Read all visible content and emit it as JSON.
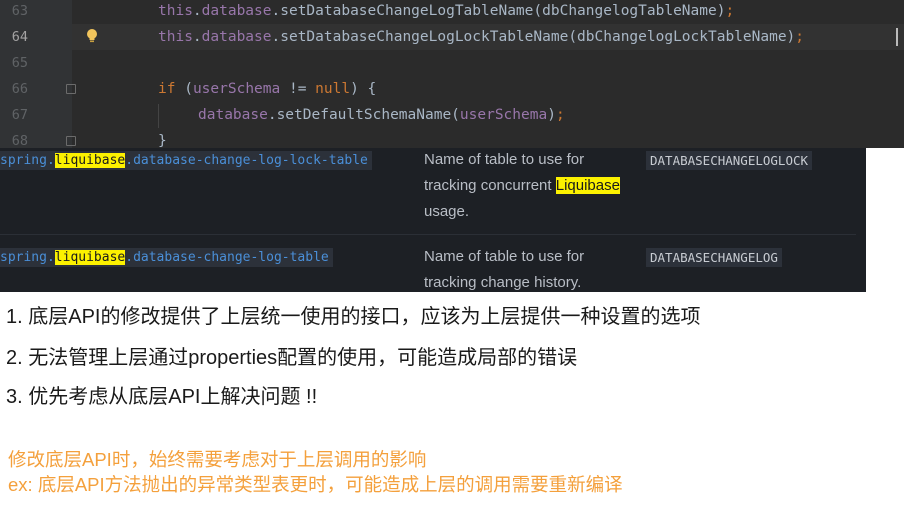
{
  "editor": {
    "lines": [
      {
        "number": "63",
        "parts": [
          [
            "field",
            "this"
          ],
          [
            "plain",
            "."
          ],
          [
            "field",
            "database"
          ],
          [
            "plain",
            "."
          ],
          [
            "plain",
            "setDatabaseChangeLogTableName(dbChangelogTableName)"
          ],
          [
            "kw",
            ";"
          ]
        ]
      },
      {
        "number": "64",
        "parts": [
          [
            "field",
            "this"
          ],
          [
            "plain",
            "."
          ],
          [
            "field",
            "database"
          ],
          [
            "plain",
            "."
          ],
          [
            "plain",
            "setDatabaseChangeLogLockTableName(dbChangelogLockTableName)"
          ],
          [
            "kw",
            ";"
          ]
        ]
      },
      {
        "number": "65",
        "parts": []
      },
      {
        "number": "66",
        "parts": [
          [
            "kw",
            "if"
          ],
          [
            "plain",
            " ("
          ],
          [
            "field",
            "userSchema"
          ],
          [
            "plain",
            " != "
          ],
          [
            "kw",
            "null"
          ],
          [
            "plain",
            ") {"
          ]
        ]
      },
      {
        "number": "67",
        "parts": [
          [
            "field",
            "database"
          ],
          [
            "plain",
            "."
          ],
          [
            "plain",
            "setDefaultSchemaName("
          ],
          [
            "field",
            "userSchema"
          ],
          [
            "plain",
            ")"
          ],
          [
            "kw",
            ";"
          ]
        ]
      },
      {
        "number": "68",
        "parts": [
          [
            "plain",
            "}"
          ]
        ]
      }
    ],
    "current_line": "64",
    "colors": {
      "background": "#2b2b2b",
      "keyword": "#cc7832",
      "field": "#9876aa",
      "text": "#a9b7c6"
    }
  },
  "docs": {
    "rows": [
      {
        "prop_prefix": "spring.",
        "prop_highlight": "liquibase",
        "prop_suffix": ".database-change-log-lock-table",
        "desc_line1": "Name of table to use for",
        "desc_line2_pre": "tracking concurrent ",
        "desc_line2_highlight": "Liquibase",
        "desc_line3": "usage.",
        "default": "DATABASECHANGELOGLOCK"
      },
      {
        "prop_prefix": "spring.",
        "prop_highlight": "liquibase",
        "prop_suffix": ".database-change-log-table",
        "desc_line1": "Name of table to use for",
        "desc_line2": "tracking change history.",
        "default": "DATABASECHANGELOG"
      }
    ],
    "colors": {
      "background": "#1d2025",
      "highlight": "#fcf100",
      "property": "#4a8fd8"
    }
  },
  "notes": {
    "item1": "1. 底层API的修改提供了上层统一使用的接口，应该为上层提供一种设置的选项",
    "item2": "2. 无法管理上层通过properties配置的使用，可能造成局部的错误",
    "item3": "3. 优先考虑从底层API上解决问题 !!",
    "orange1": "修改底层API时，始终需要考虑对于上层调用的影响",
    "orange2": "ex: 底层API方法抛出的异常类型表更时，可能造成上层的调用需要重新编译",
    "orange_color": "#f4a03c"
  }
}
